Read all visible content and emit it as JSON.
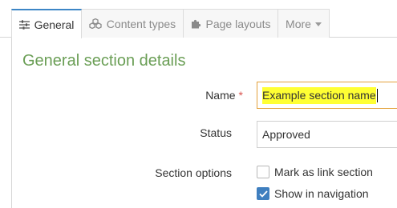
{
  "tabs": [
    {
      "label": "General",
      "icon": "sliders-icon",
      "active": true
    },
    {
      "label": "Content types",
      "icon": "cubes-icon",
      "active": false
    },
    {
      "label": "Page layouts",
      "icon": "puzzle-icon",
      "active": false
    },
    {
      "label": "More",
      "icon": "caret-down-icon",
      "active": false
    }
  ],
  "section": {
    "title": "General section details"
  },
  "form": {
    "name_label": "Name",
    "required_mark": "*",
    "name_value": "Example section name",
    "status_label": "Status",
    "status_value": "Approved",
    "options_label": "Section options",
    "options": [
      {
        "label": "Mark as link section",
        "checked": false
      },
      {
        "label": "Show in navigation",
        "checked": true
      }
    ]
  },
  "colors": {
    "accent_blue": "#3d86c6",
    "title_green": "#6a9e55",
    "highlight_yellow": "#ffff33",
    "focus_border": "#e3a23b",
    "required_red": "#d9534f"
  }
}
